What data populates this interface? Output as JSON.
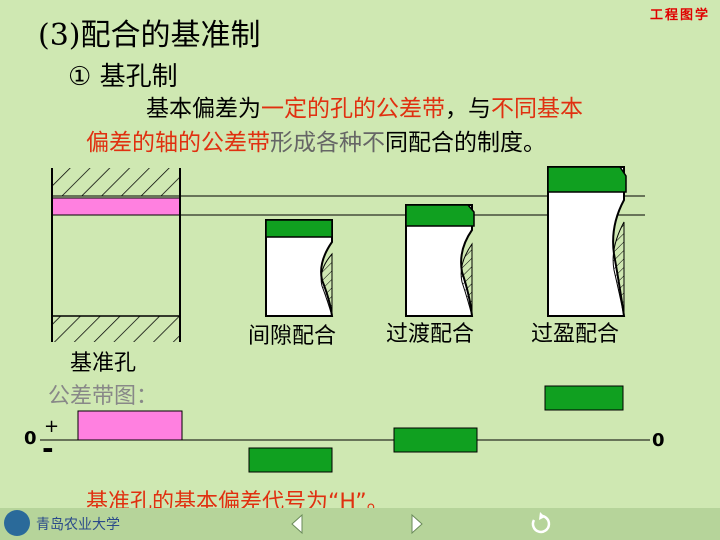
{
  "header": {
    "title": "(3)配合的基准制",
    "corner_label": "工程图学",
    "subtitle": "①  基孔制"
  },
  "definition": {
    "line1_a": "基本偏差为",
    "line1_b": "一定的孔的公差带",
    "line1_c": "，与",
    "line1_d": "不同基本",
    "line2_a": "偏差的轴的公差带",
    "line2_b": "形成各种",
    "line2_c": "不",
    "line2_d": "同配合的制度。"
  },
  "diagram": {
    "hole_label": "基准孔",
    "fits": [
      "间隙配合",
      "过渡配合",
      "过盈配合"
    ]
  },
  "tolerance_chart": {
    "label": "公差带图：",
    "zero_left": "0",
    "plus": "+",
    "minus": "-",
    "zero_right": "0"
  },
  "footer": {
    "note": "基准孔的基本偏差代号为“H”。",
    "logo_text": "青岛农业大学"
  },
  "nav": {
    "icons": [
      "prev-icon",
      "next-icon",
      "return-icon"
    ]
  },
  "colors": {
    "background": "#cfe8b2",
    "hole_band": "#ff80e0",
    "shaft_band": "#10a020",
    "red_text": "#e03010"
  }
}
